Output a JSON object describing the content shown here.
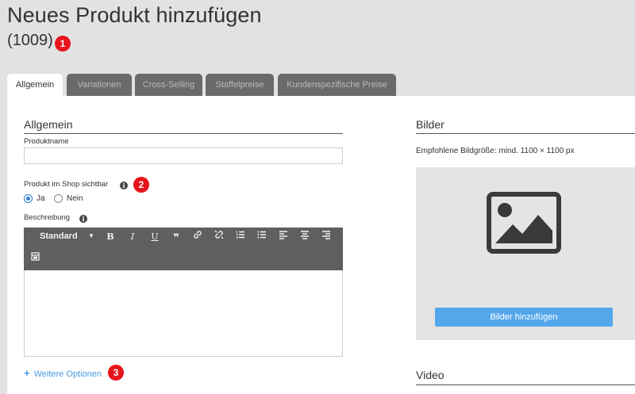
{
  "header": {
    "title": "Neues Produkt hinzufügen",
    "subtitle": "(1009)"
  },
  "markers": [
    "1",
    "2",
    "3"
  ],
  "tabs": [
    {
      "label": "Allgemein",
      "active": true
    },
    {
      "label": "Variationen",
      "active": false
    },
    {
      "label": "Cross-Selling",
      "active": false
    },
    {
      "label": "Staffelpreise",
      "active": false
    },
    {
      "label": "Kundenspezifische Preise",
      "active": false
    }
  ],
  "general": {
    "heading": "Allgemein",
    "product_name_label": "Produktname",
    "product_name_value": "",
    "visibility_label": "Produkt im Shop sichtbar",
    "visibility_options": [
      "Ja",
      "Nein"
    ],
    "visibility_selected": "Ja",
    "description_label": "Beschreibung",
    "editor": {
      "format_select": "Standard",
      "toolbar_buttons": [
        "bold",
        "italic",
        "underline",
        "blockquote",
        "link",
        "unlink",
        "ordered-list",
        "unordered-list",
        "align-left",
        "align-center",
        "align-right",
        "image"
      ]
    },
    "more_options": "Weitere Optionen"
  },
  "images": {
    "heading": "Bilder",
    "hint": "Empfohlene Bildgröße: mind. 1100 × 1100 px",
    "add_button": "Bilder hinzufügen"
  },
  "video": {
    "heading": "Video"
  },
  "colors": {
    "accent": "#55a7ec",
    "marker": "#e8141c",
    "toolbar": "#5f5f5f"
  }
}
